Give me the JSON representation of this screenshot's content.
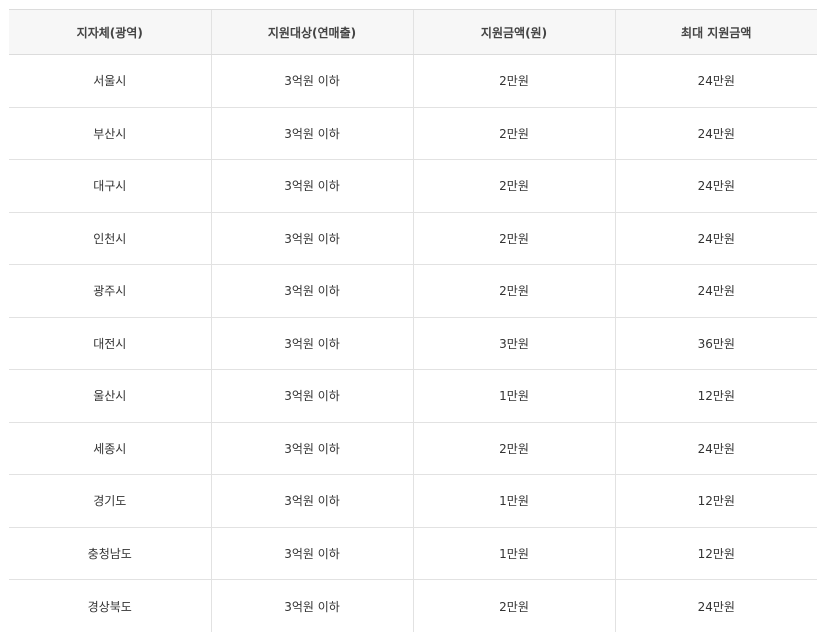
{
  "table": {
    "headers": [
      "지자체(광역)",
      "지원대상(연매출)",
      "지원금액(원)",
      "최대 지원금액"
    ],
    "rows": [
      [
        "서울시",
        "3억원 이하",
        "2만원",
        "24만원"
      ],
      [
        "부산시",
        "3억원 이하",
        "2만원",
        "24만원"
      ],
      [
        "대구시",
        "3억원 이하",
        "2만원",
        "24만원"
      ],
      [
        "인천시",
        "3억원 이하",
        "2만원",
        "24만원"
      ],
      [
        "광주시",
        "3억원 이하",
        "2만원",
        "24만원"
      ],
      [
        "대전시",
        "3억원 이하",
        "3만원",
        "36만원"
      ],
      [
        "울산시",
        "3억원 이하",
        "1만원",
        "12만원"
      ],
      [
        "세종시",
        "3억원 이하",
        "2만원",
        "24만원"
      ],
      [
        "경기도",
        "3억원 이하",
        "1만원",
        "12만원"
      ],
      [
        "충청남도",
        "3억원 이하",
        "1만원",
        "12만원"
      ],
      [
        "경상북도",
        "3억원 이하",
        "2만원",
        "24만원"
      ]
    ]
  }
}
